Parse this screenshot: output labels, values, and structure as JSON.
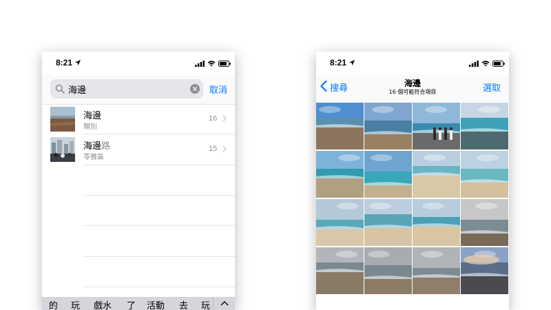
{
  "colors": {
    "accent": "#007aff",
    "secondary_text": "#8e8e93",
    "separator": "#e5e5ea"
  },
  "left_phone": {
    "status": {
      "time": "8:21"
    },
    "search": {
      "query": "海邊",
      "cancel_label": "取消"
    },
    "results": [
      {
        "title": "海邊",
        "title_suffix": "",
        "subtitle": "類別",
        "count": "16"
      },
      {
        "title": "海邊",
        "title_suffix": "路",
        "subtitle": "苓雅區",
        "count": "15"
      }
    ],
    "keyboard_suggestions": [
      "的",
      "玩",
      "戲水",
      "了",
      "活動",
      "去",
      "玩"
    ]
  },
  "right_phone": {
    "status": {
      "time": "8:21"
    },
    "nav": {
      "back_label": "搜尋",
      "title": "海邊",
      "subtitle": "16 個可能符合項目",
      "select_label": "選取"
    },
    "photo_count": 16,
    "photos": [
      {
        "scene": "beach-blue-sky",
        "sky": "#4f8fd0",
        "sea": "#5a8fb0",
        "ground": "#8c7560"
      },
      {
        "scene": "beach-cloudy-sky",
        "sky": "#7ea6cf",
        "sea": "#4a7ea2",
        "ground": "#9a8062"
      },
      {
        "scene": "people-on-rocks",
        "sky": "#8fb7da",
        "sea": "#3a8ab0",
        "ground": "#6a6a6a"
      },
      {
        "scene": "sea-with-rocks",
        "sky": "#c7d6e4",
        "sea": "#3ea2b8",
        "ground": "#4d6a70"
      },
      {
        "scene": "waves-shore",
        "sky": "#7fb2d8",
        "sea": "#2f9cb0",
        "ground": "#b0a080"
      },
      {
        "scene": "waves-shore",
        "sky": "#6ea4d0",
        "sea": "#3aa6b8",
        "ground": "#c4b08e"
      },
      {
        "scene": "sandy-shore",
        "sky": "#b9cfe0",
        "sea": "#6ab4c4",
        "ground": "#d9c8a6"
      },
      {
        "scene": "sandy-shore",
        "sky": "#bcd2e2",
        "sea": "#6ab8c0",
        "ground": "#d4c09c"
      },
      {
        "scene": "calm-sea",
        "sky": "#b4c8d8",
        "sea": "#5aa8bc",
        "ground": "#d8c8a8"
      },
      {
        "scene": "calm-sea",
        "sky": "#bccede",
        "sea": "#5aa4b8",
        "ground": "#d6c4a4"
      },
      {
        "scene": "calm-sea",
        "sky": "#b8ccdc",
        "sea": "#4aa0b8",
        "ground": "#d8c6a2"
      },
      {
        "scene": "overcast-beach",
        "sky": "#c6c8c8",
        "sea": "#7c8c94",
        "ground": "#7a6a5a"
      },
      {
        "scene": "grey-beach",
        "sky": "#b2b6ba",
        "sea": "#7c8a90",
        "ground": "#8a7a68"
      },
      {
        "scene": "grey-beach",
        "sky": "#a8acb0",
        "sea": "#7a8890",
        "ground": "#8c7c66"
      },
      {
        "scene": "grey-beach",
        "sky": "#b0b4b8",
        "sea": "#7e8a92",
        "ground": "#8e7e6a"
      },
      {
        "scene": "sunset-clouds",
        "sky": "#8ca2c4",
        "sea": "#5a6e8a",
        "ground": "#4a4a50"
      }
    ]
  }
}
